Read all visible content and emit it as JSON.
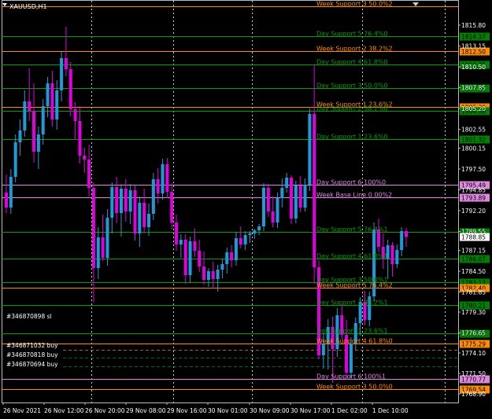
{
  "symbol": "XAUUSD,H1",
  "colors": {
    "background": "#000000",
    "grid": "#ffffff",
    "bull": "#1e9bd7",
    "bear": "#e000e0",
    "week_line": "#ff8c00",
    "day_line": "#00a000",
    "violet_line": "#dd88dd",
    "current_price_box": "#ffffff"
  },
  "price_labels": [
    "1815.80",
    "1813.15",
    "1810.50",
    "1807.85",
    "1805.20",
    "1802.55",
    "1800.15",
    "1797.50",
    "1794.85",
    "1792.20",
    "1789.55",
    "1787.15",
    "1784.50",
    "1781.85",
    "1779.30",
    "1776.65",
    "1774.10",
    "1771.50",
    "1768.90"
  ],
  "time_labels": [
    "26 Nov 2021",
    "26 Nov 12:00",
    "26 Nov 20:00",
    "29 Nov 08:00",
    "29 Nov 16:00",
    "30 Nov 01:00",
    "30 Nov 09:00",
    "30 Nov 17:00",
    "1 Dec 02:00",
    "1 Dec 10:00"
  ],
  "levels": [
    {
      "label": "Week Support 3 50.0%2",
      "kind": "week",
      "price": "1818.15",
      "tag": ""
    },
    {
      "label": "Day Support 5 76.4%0",
      "kind": "day",
      "price": "1814.37",
      "tag": "1814.37"
    },
    {
      "label": "Week Support 2 38.2%2",
      "kind": "week",
      "price": "1812.50",
      "tag": "1812.50"
    },
    {
      "label": "Day Support 4 61.8%0",
      "kind": "day",
      "price": "1810.75",
      "tag": "1810.75"
    },
    {
      "label": "Day Support 3 50.0%0",
      "kind": "day",
      "price": "1807.84",
      "tag": "1807.84"
    },
    {
      "label": "Week Support 1 23.6%2",
      "kind": "week",
      "price": "1805.39",
      "tag": "1805.39"
    },
    {
      "label": "Day Support 2 38.2%0",
      "kind": "day",
      "price": "1804.88",
      "tag": "1804.88"
    },
    {
      "label": "Day Support 1 23.6%0",
      "kind": "day",
      "price": "1801.32",
      "tag": "1801.32"
    },
    {
      "label": "Day Support 6 100%0",
      "kind": "violet",
      "price": "1795.49",
      "tag": "1795.49"
    },
    {
      "label": "Week Base Line 0.00%2",
      "kind": "violet",
      "price": "1793.89",
      "tag": "1793.89"
    },
    {
      "label": "Day Support 5 76.4%1",
      "kind": "day",
      "price": "1789.45",
      "tag": "1789.45"
    },
    {
      "label": "Day Support 4 61.8%1",
      "kind": "day",
      "price": "1786.07",
      "tag": "1786.07"
    },
    {
      "label": "Day Support 3 50.0%1",
      "kind": "day",
      "price": "1783.13",
      "tag": "1783.13"
    },
    {
      "label": "Week Support 5 76.4%2",
      "kind": "week",
      "price": "1782.40",
      "tag": "1782.40"
    },
    {
      "label": "Day Support 2 38.2%1",
      "kind": "day",
      "price": "1780.21",
      "tag": "1780.21"
    },
    {
      "label": "Day Support 1 23.6%1",
      "kind": "day",
      "price": "1776.63",
      "tag": "1776.63"
    },
    {
      "label": "Week Support 4 61.8%0",
      "kind": "week",
      "price": "1775.29",
      "tag": "1775.29"
    },
    {
      "label": "Day Support 6 100%1",
      "kind": "violet",
      "price": "1770.77",
      "tag": "1770.77"
    },
    {
      "label": "Week Support 3 50.0%0",
      "kind": "week",
      "price": "1769.54",
      "tag": "1769.54"
    }
  ],
  "current_price": "1788.85",
  "orders": [
    {
      "label": "#346870898 sl"
    },
    {
      "label": "#346871032 buy"
    },
    {
      "label": "#346870818 buy"
    },
    {
      "label": "#346870694 buy"
    }
  ],
  "candles": [
    [
      1794.5,
      1796.8,
      1791.9,
      1792.6
    ],
    [
      1792.6,
      1797.5,
      1791.8,
      1796.5
    ],
    [
      1796.5,
      1801.9,
      1795.8,
      1800.9
    ],
    [
      1800.9,
      1803.8,
      1799.2,
      1802.4
    ],
    [
      1802.4,
      1807.5,
      1801.6,
      1806.1
    ],
    [
      1806.1,
      1810.3,
      1803.6,
      1804.9
    ],
    [
      1804.9,
      1808.4,
      1798.3,
      1799.7
    ],
    [
      1799.7,
      1802.9,
      1797.5,
      1801.9
    ],
    [
      1801.9,
      1806.4,
      1800.6,
      1805.5
    ],
    [
      1805.5,
      1809.2,
      1804.1,
      1808.4
    ],
    [
      1808.4,
      1810.0,
      1802.9,
      1803.8
    ],
    [
      1803.8,
      1808.8,
      1802.5,
      1807.5
    ],
    [
      1807.5,
      1812.4,
      1806.1,
      1811.6
    ],
    [
      1811.6,
      1815.6,
      1809.3,
      1810.2
    ],
    [
      1810.2,
      1811.1,
      1804.2,
      1805.1
    ],
    [
      1805.1,
      1806.0,
      1801.2,
      1803.6
    ],
    [
      1803.6,
      1805.5,
      1798.2,
      1799.2
    ],
    [
      1799.2,
      1800.2,
      1797.0,
      1798.7
    ],
    [
      1798.7,
      1800.6,
      1794.0,
      1795.1
    ],
    [
      1795.1,
      1795.8,
      1780.5,
      1784.9
    ],
    [
      1784.9,
      1790.1,
      1783.5,
      1788.8
    ],
    [
      1788.8,
      1791.7,
      1785.8,
      1786.2
    ],
    [
      1786.2,
      1792.4,
      1785.2,
      1791.3
    ],
    [
      1791.3,
      1795.8,
      1789.3,
      1795.2
    ],
    [
      1795.2,
      1796.5,
      1790.6,
      1791.9
    ],
    [
      1791.9,
      1795.6,
      1788.9,
      1795.0
    ],
    [
      1795.0,
      1796.2,
      1790.8,
      1792.1
    ],
    [
      1792.1,
      1795.6,
      1790.5,
      1794.8
    ],
    [
      1794.8,
      1795.4,
      1788.4,
      1789.3
    ],
    [
      1789.3,
      1794.0,
      1787.6,
      1793.2
    ],
    [
      1793.2,
      1795.0,
      1789.3,
      1790.1
    ],
    [
      1790.1,
      1793.1,
      1789.0,
      1791.8
    ],
    [
      1791.8,
      1797.0,
      1791.0,
      1796.2
    ],
    [
      1796.2,
      1797.6,
      1793.1,
      1794.4
    ],
    [
      1794.4,
      1798.8,
      1793.6,
      1798.1
    ],
    [
      1798.1,
      1798.9,
      1793.8,
      1794.6
    ],
    [
      1794.6,
      1795.7,
      1789.8,
      1790.7
    ],
    [
      1790.7,
      1791.7,
      1787.1,
      1787.9
    ],
    [
      1787.9,
      1789.2,
      1786.2,
      1788.5
    ],
    [
      1788.5,
      1789.2,
      1782.9,
      1784.0
    ],
    [
      1784.0,
      1788.9,
      1783.0,
      1788.3
    ],
    [
      1788.3,
      1789.9,
      1786.3,
      1787.1
    ],
    [
      1787.1,
      1788.5,
      1784.4,
      1785.1
    ],
    [
      1785.1,
      1787.0,
      1782.8,
      1783.4
    ],
    [
      1783.4,
      1784.9,
      1782.5,
      1784.5
    ],
    [
      1784.5,
      1785.7,
      1782.3,
      1783.5
    ],
    [
      1783.5,
      1785.3,
      1781.9,
      1784.7
    ],
    [
      1784.7,
      1786.1,
      1783.6,
      1785.4
    ],
    [
      1785.4,
      1787.5,
      1784.2,
      1786.9
    ],
    [
      1786.9,
      1787.8,
      1785.0,
      1785.9
    ],
    [
      1785.9,
      1789.5,
      1785.2,
      1788.7
    ],
    [
      1788.7,
      1790.2,
      1787.4,
      1787.9
    ],
    [
      1787.9,
      1789.6,
      1787.2,
      1789.1
    ],
    [
      1789.1,
      1789.6,
      1788.1,
      1789.3
    ],
    [
      1789.3,
      1789.9,
      1788.6,
      1789.7
    ],
    [
      1789.7,
      1790.5,
      1789.1,
      1790.2
    ],
    [
      1790.2,
      1795.7,
      1789.6,
      1795.1
    ],
    [
      1795.1,
      1795.6,
      1791.4,
      1792.1
    ],
    [
      1792.1,
      1794.0,
      1790.1,
      1790.7
    ],
    [
      1790.7,
      1794.5,
      1790.0,
      1793.8
    ],
    [
      1793.8,
      1796.3,
      1792.6,
      1795.1
    ],
    [
      1795.1,
      1797.0,
      1794.5,
      1796.4
    ],
    [
      1796.4,
      1796.7,
      1790.5,
      1791.2
    ],
    [
      1791.2,
      1796.0,
      1790.6,
      1795.4
    ],
    [
      1795.4,
      1796.6,
      1792.0,
      1792.6
    ],
    [
      1792.6,
      1796.3,
      1792.1,
      1795.5
    ],
    [
      1795.5,
      1805.2,
      1794.7,
      1804.5
    ],
    [
      1804.5,
      1810.8,
      1782.9,
      1785.0
    ],
    [
      1785.0,
      1785.9,
      1773.3,
      1773.8
    ],
    [
      1773.8,
      1776.6,
      1772.1,
      1775.3
    ],
    [
      1775.3,
      1778.4,
      1772.0,
      1777.4
    ],
    [
      1777.4,
      1778.7,
      1770.3,
      1774.6
    ],
    [
      1774.6,
      1779.8,
      1773.6,
      1778.9
    ],
    [
      1778.9,
      1780.3,
      1775.8,
      1776.4
    ],
    [
      1776.4,
      1778.3,
      1770.7,
      1771.6
    ],
    [
      1771.6,
      1776.1,
      1770.9,
      1775.3
    ],
    [
      1775.3,
      1778.6,
      1774.5,
      1777.9
    ],
    [
      1777.9,
      1781.2,
      1776.3,
      1780.6
    ],
    [
      1780.6,
      1782.0,
      1777.6,
      1778.3
    ],
    [
      1778.3,
      1781.9,
      1777.5,
      1781.3
    ],
    [
      1781.3,
      1790.7,
      1780.6,
      1789.8
    ],
    [
      1789.8,
      1791.2,
      1786.9,
      1787.6
    ],
    [
      1787.6,
      1789.3,
      1784.8,
      1786.1
    ],
    [
      1786.1,
      1788.5,
      1783.5,
      1787.8
    ],
    [
      1787.8,
      1788.2,
      1783.8,
      1785.4
    ],
    [
      1785.4,
      1787.9,
      1784.9,
      1787.2
    ],
    [
      1787.2,
      1790.1,
      1786.4,
      1789.6
    ],
    [
      1789.6,
      1790.0,
      1787.6,
      1788.85
    ]
  ]
}
